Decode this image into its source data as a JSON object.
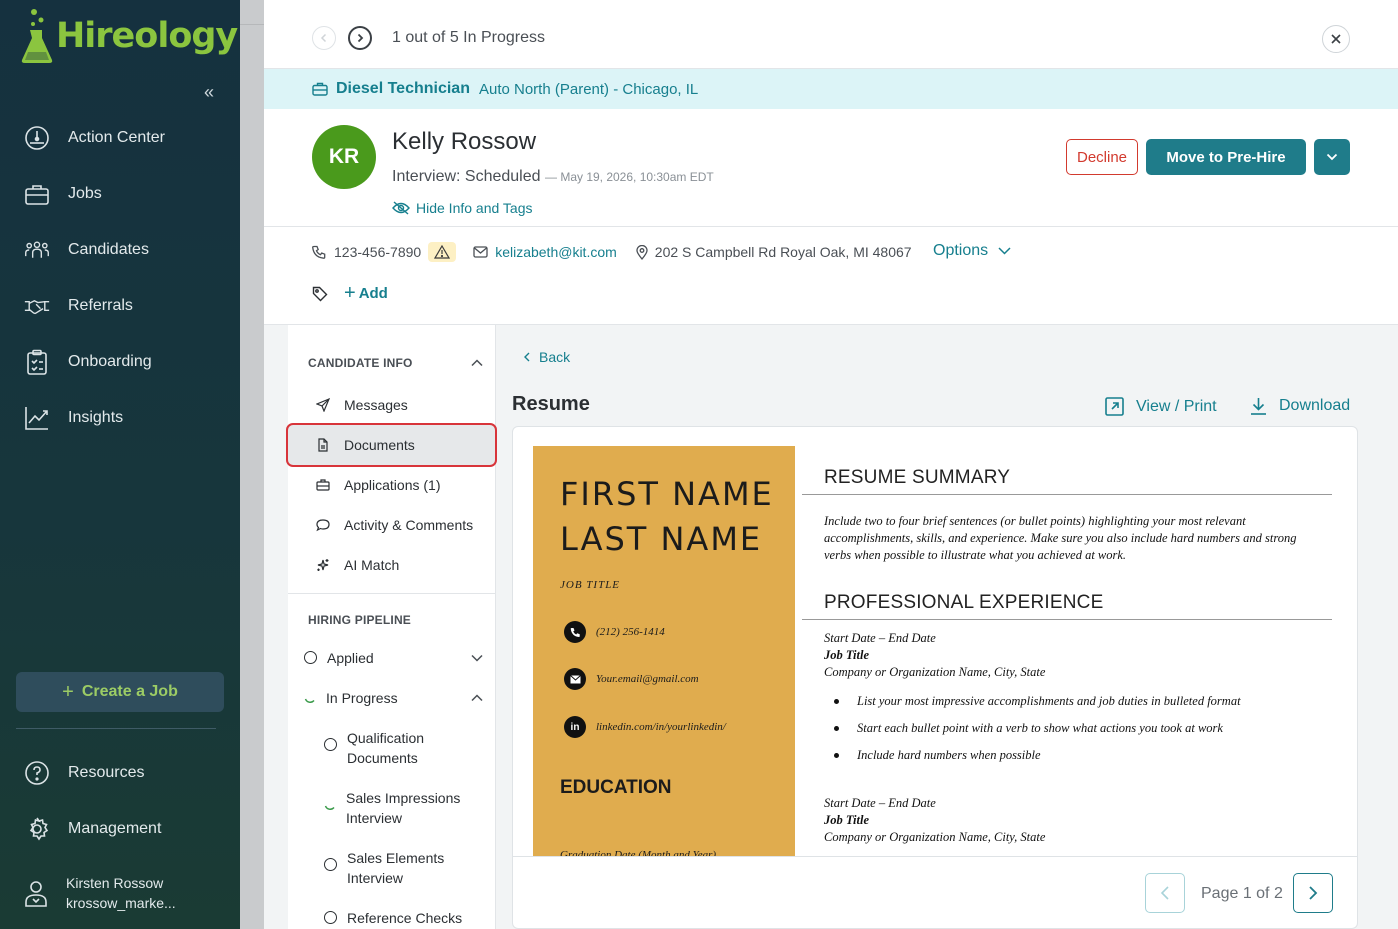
{
  "sidebar": {
    "logo_text": "Hireology",
    "nav": [
      {
        "label": "Action Center",
        "icon": "gauge-icon"
      },
      {
        "label": "Jobs",
        "icon": "briefcase-icon"
      },
      {
        "label": "Candidates",
        "icon": "people-icon"
      },
      {
        "label": "Referrals",
        "icon": "handshake-icon"
      },
      {
        "label": "Onboarding",
        "icon": "clipboard-icon"
      },
      {
        "label": "Insights",
        "icon": "chart-icon"
      }
    ],
    "create_job_label": "Create a Job",
    "bottom_nav": [
      {
        "label": "Resources",
        "icon": "help-icon"
      },
      {
        "label": "Management",
        "icon": "gear-icon"
      }
    ],
    "user_name": "Kirsten Rossow",
    "user_handle": "krossow_marke..."
  },
  "topbar": {
    "progress_text": "1 out of 5 In Progress"
  },
  "job_banner": {
    "title": "Diesel Technician",
    "location": "Auto North (Parent) - Chicago, IL"
  },
  "candidate": {
    "initials": "KR",
    "name": "Kelly Rossow",
    "status": "Interview: Scheduled",
    "status_date": "— May 19, 2026, 10:30am EDT",
    "hide_info_label": "Hide Info and Tags",
    "phone": "123-456-7890",
    "email": "kelizabeth@kit.com",
    "address": "202 S Campbell Rd Royal Oak, MI 48067",
    "options_label": "Options",
    "add_tag_label": "Add"
  },
  "actions": {
    "decline": "Decline",
    "move": "Move to Pre-Hire"
  },
  "candidate_info": {
    "heading": "CANDIDATE INFO",
    "items": [
      {
        "label": "Messages",
        "icon": "send-icon"
      },
      {
        "label": "Documents",
        "icon": "document-icon"
      },
      {
        "label": "Applications (1)",
        "icon": "briefcase-icon"
      },
      {
        "label": "Activity & Comments",
        "icon": "comment-icon"
      },
      {
        "label": "AI Match",
        "icon": "sparkle-icon"
      }
    ]
  },
  "pipeline": {
    "heading": "HIRING PIPELINE",
    "stages": [
      {
        "label": "Applied"
      },
      {
        "label": "In Progress"
      },
      {
        "label": "Qualification Documents"
      },
      {
        "label": "Sales Impressions Interview"
      },
      {
        "label": "Sales Elements Interview"
      },
      {
        "label": "Reference Checks"
      }
    ]
  },
  "document": {
    "back_label": "Back",
    "title": "Resume",
    "view_print_label": "View / Print",
    "download_label": "Download",
    "page_text": "Page 1 of 2"
  },
  "resume": {
    "first_name": "FIRST NAME",
    "last_name": "LAST NAME",
    "job_title": "JOB TITLE",
    "phone": "(212) 256-1414",
    "email": "Your.email@gmail.com",
    "linkedin": "linkedin.com/in/yourlinkedin/",
    "linkedin_badge": "in",
    "education_heading": "EDUCATION",
    "graduation": "Graduation Date (Month and Year)",
    "summary_heading": "RESUME SUMMARY",
    "summary_text": "Include two to four brief sentences (or bullet points) highlighting your most relevant accomplishments, skills, and experience. Make sure you also include hard numbers and strong verbs when possible to illustrate what you achieved at work.",
    "experience_heading": "PROFESSIONAL EXPERIENCE",
    "job1_dates": "Start Date – End Date",
    "job1_title": "Job Title",
    "job1_company": "Company or Organization Name, City, State",
    "bullets": [
      "List your most impressive accomplishments and job duties in bulleted format",
      "Start each bullet point with a verb to show what actions you took at work",
      "Include hard numbers when possible"
    ],
    "job2_dates": "Start Date – End Date",
    "job2_title": "Job Title",
    "job2_company": "Company or Organization Name, City, State"
  }
}
